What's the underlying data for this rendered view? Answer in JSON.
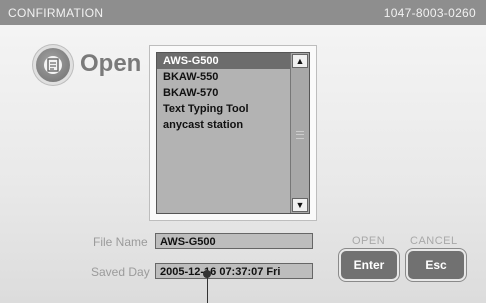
{
  "title_bar": {
    "title": "CONFIRMATION",
    "code": "1047-8003-0260"
  },
  "header": {
    "icon": "document-icon",
    "label": "Open"
  },
  "file_list": {
    "items": [
      "AWS-G500",
      "BKAW-550",
      "BKAW-570",
      "Text Typing Tool",
      "anycast station"
    ],
    "selected_index": 0,
    "scroll_up": "▲",
    "scroll_down": "▼"
  },
  "fields": {
    "file_name_label": "File Name",
    "file_name_value": "AWS-G500",
    "saved_day_label": "Saved Day",
    "saved_day_value": "2005-12-16 07:37:07 Fri"
  },
  "buttons": {
    "open_caption": "OPEN",
    "open_key": "Enter",
    "cancel_caption": "CANCEL",
    "cancel_key": "Esc"
  }
}
